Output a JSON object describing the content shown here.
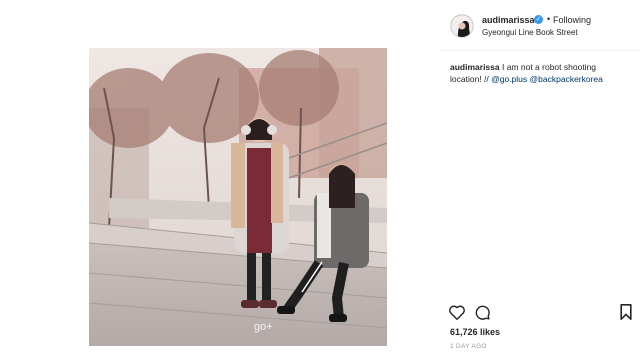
{
  "post": {
    "username": "audimarissa",
    "follow_separator": "•",
    "follow_state": "Following",
    "location": "Gyeongui Line Book Street",
    "caption": {
      "username": "audimarissa",
      "text": " I am not a robot shooting location! // ",
      "mention1": "@go.plus",
      "space": " ",
      "mention2": "@backpackerkorea"
    },
    "likes": "61,726 likes",
    "time_ago": "1 DAY AGO",
    "photo_watermark": "go+"
  },
  "icons": {
    "like": "heart-icon",
    "comment": "comment-icon",
    "save": "bookmark-icon",
    "verified": "verified-badge-icon"
  },
  "colors": {
    "verified": "#3897f0",
    "mention": "#003569",
    "muted": "#999999"
  }
}
